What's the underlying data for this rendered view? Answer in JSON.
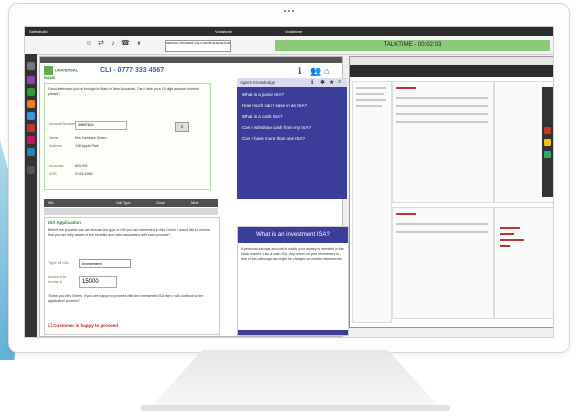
{
  "topbar": {
    "title": "Salesbuild",
    "center_a": "Vodafone",
    "center_b": "Vodafone"
  },
  "toolbar": {
    "search_label": "MANUAL TOOLBAR CALL FROM QUEUE FOR",
    "call_status": "TALKTIME - 00:02:03"
  },
  "crm": {
    "logo_name": "UNIVERSAL BANK",
    "cli": "CLI - 0777 333 4567",
    "script_text": "Good afternoon you're through to Mark in New Accounts. Can I take your 16 digit account number please?",
    "fields": [
      {
        "label": "Account Number",
        "value": "39897624"
      },
      {
        "label": "Name",
        "value": "Mrs Candace Green"
      },
      {
        "label": "Address",
        "value": "108 Apple Park"
      },
      {
        "label": "Accounts",
        "value": "803,992"
      },
      {
        "label": "DOB",
        "value": "01/01/1980"
      }
    ]
  },
  "tabs": [
    "ISA",
    "Call Type",
    "Close",
    "Next"
  ],
  "isa": {
    "title": "ISA Application",
    "intro": "Before we proceed can we discuss the type of ISA you are interested in Mrs Green I would like to ensure that you are fully aware of the benefits and risks associated with each product?",
    "type_label": "Type of ISA",
    "type_value": "Investment",
    "amount_label": "Amount to Invest £",
    "amount_value": "15000",
    "outro": "Thank you Mrs Green, if you are happy to proceed with the Investment ISA then I will continue to the application process?",
    "checkbox": "Customer is happy to proceed"
  },
  "agent_knowledge": {
    "header": "Agent Knowledge",
    "questions": [
      "What is a junior ISA?",
      "How much can I save in an ISA?",
      "What is a cash ISA?",
      "Can I withdraw cash from my ISA?",
      "Can I have more than one ISA?"
    ]
  },
  "invest": {
    "title": "What is an investment ISA?",
    "body": "A personal savings account in which your money is invested in the stock market. Like a cash ISA, any return on your investment is free of tax, although tax might be charged on certain investments."
  },
  "colors": {
    "accent": "#3a3e98",
    "call_green": "#8dc97a",
    "crm_red": "#b33333"
  }
}
